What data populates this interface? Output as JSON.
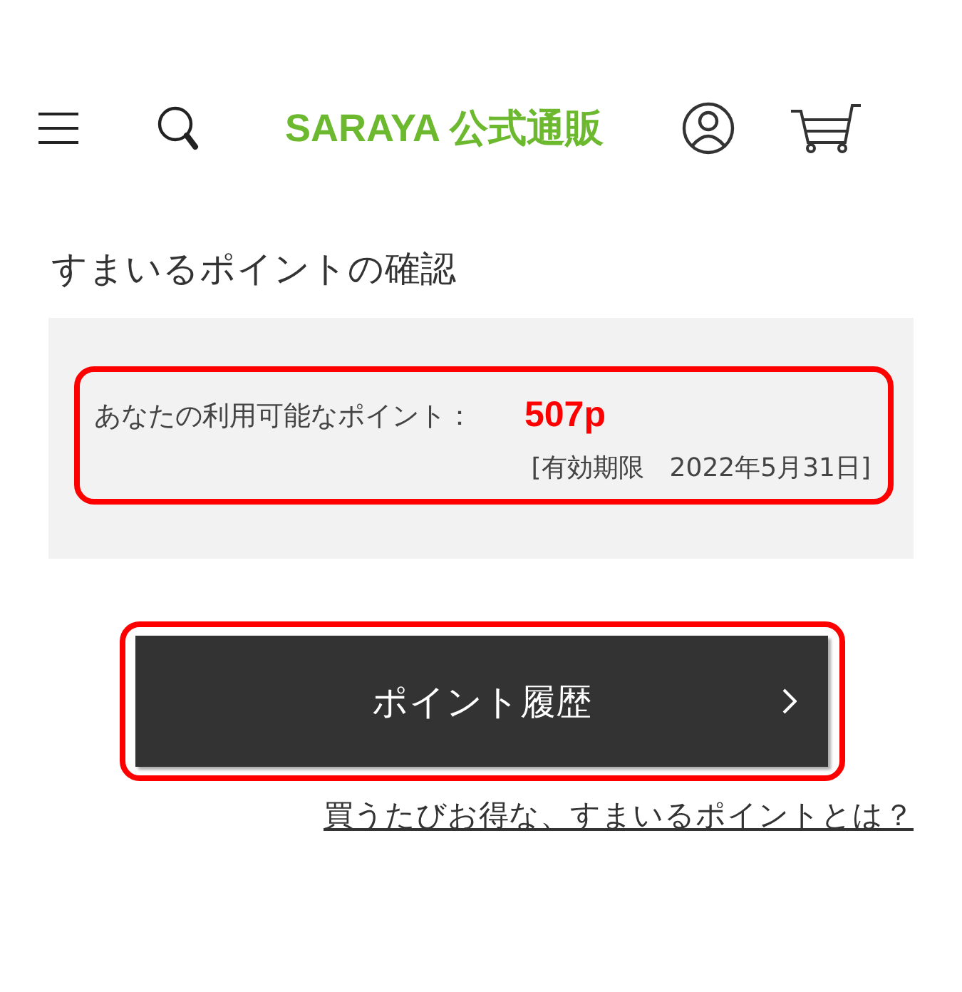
{
  "header": {
    "logo": {
      "brand": "SARAYA",
      "suffix": "公式通販"
    }
  },
  "page_title": "すまいるポイントの確認",
  "points_panel": {
    "label": "あなたの利用可能なポイント：",
    "points": "507p",
    "expiry": "[有効期限　2022年5月31日]",
    "highlighted": true
  },
  "history_button": {
    "label": "ポイント履歴",
    "highlighted": true
  },
  "info_link": "買うたびお得な、すまいるポイントとは？"
}
